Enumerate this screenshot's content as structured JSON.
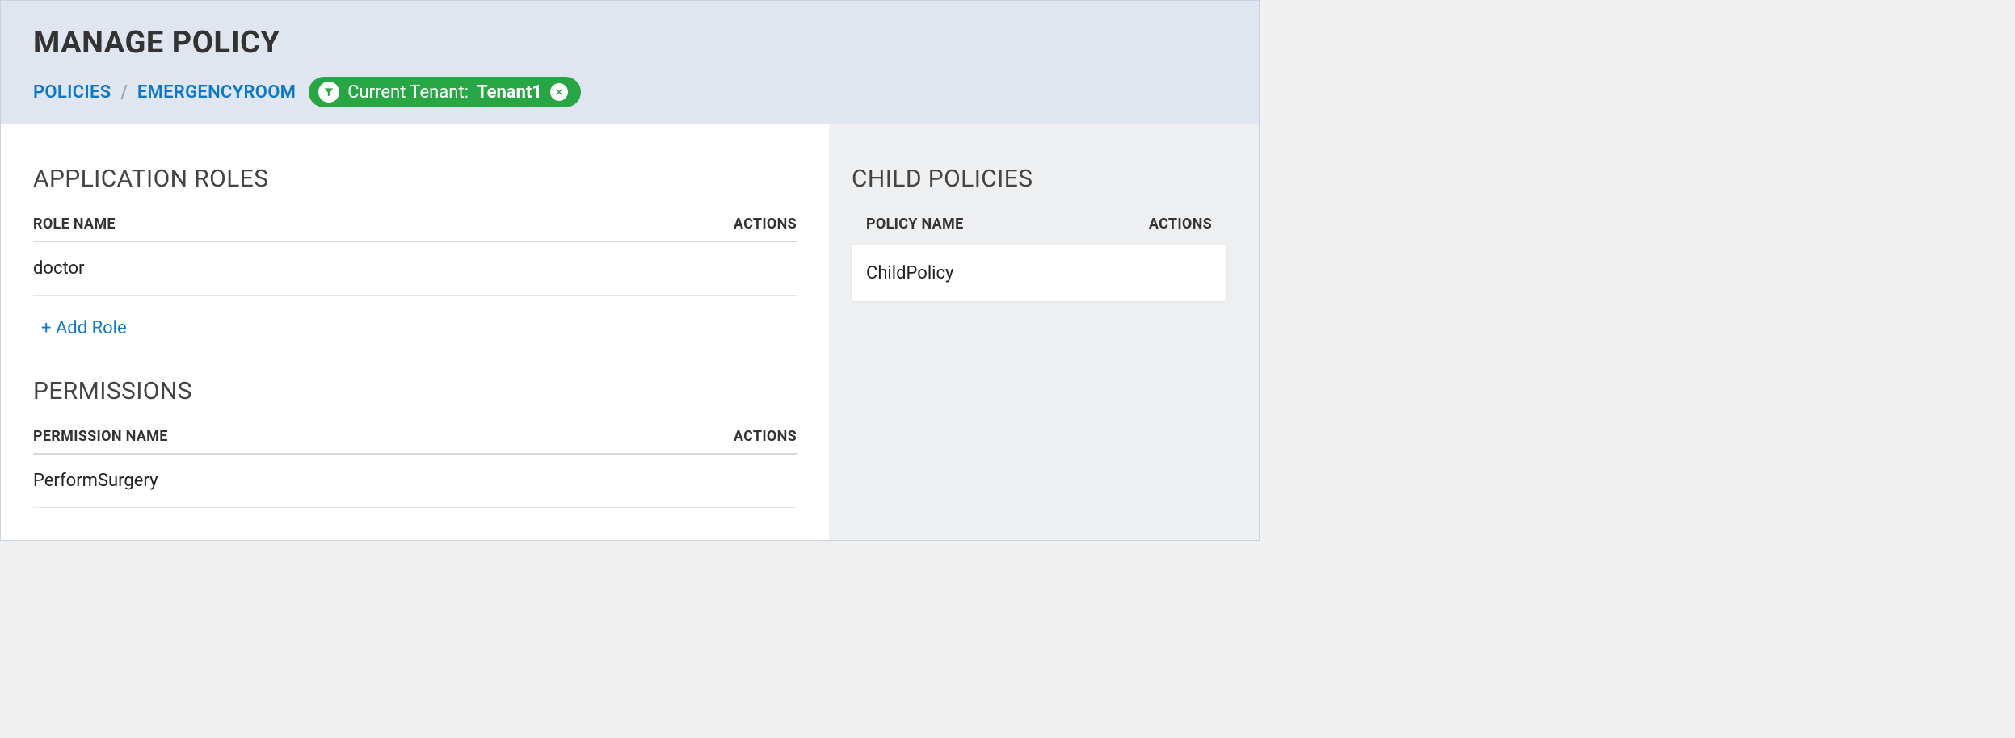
{
  "header": {
    "title": "MANAGE POLICY",
    "breadcrumb": {
      "root": "POLICIES",
      "current": "EMERGENCYROOM"
    },
    "tenant": {
      "label": "Current Tenant:",
      "name": "Tenant1"
    }
  },
  "roles": {
    "title": "APPLICATION ROLES",
    "columns": {
      "name": "ROLE NAME",
      "actions": "ACTIONS"
    },
    "items": [
      {
        "name": "doctor"
      }
    ],
    "addLabel": "+ Add Role"
  },
  "permissions": {
    "title": "PERMISSIONS",
    "columns": {
      "name": "PERMISSION NAME",
      "actions": "ACTIONS"
    },
    "items": [
      {
        "name": "PerformSurgery"
      }
    ]
  },
  "childPolicies": {
    "title": "CHILD POLICIES",
    "columns": {
      "name": "POLICY NAME",
      "actions": "ACTIONS"
    },
    "items": [
      {
        "name": "ChildPolicy"
      }
    ]
  }
}
